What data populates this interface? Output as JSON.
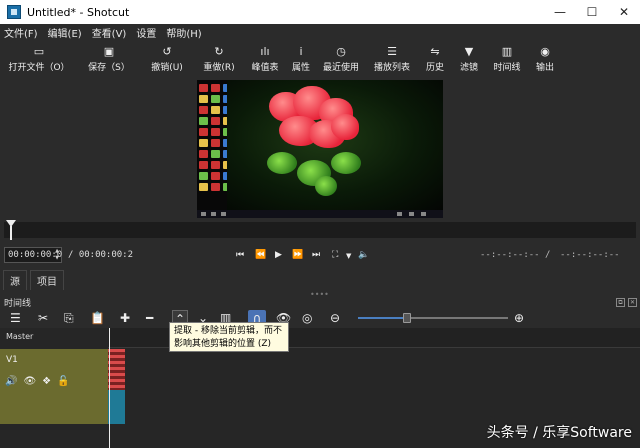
{
  "window": {
    "title": "Untitled* - Shotcut"
  },
  "menu": [
    "文件(F)",
    "编辑(E)",
    "查看(V)",
    "设置",
    "帮助(H)"
  ],
  "toolbar": [
    {
      "icon": "folder-open-icon",
      "glyph": "▭",
      "label": "打开文件（O）"
    },
    {
      "icon": "save-icon",
      "glyph": "▣",
      "label": "保存（S）"
    },
    {
      "icon": "undo-icon",
      "glyph": "↺",
      "label": "撤销(U)"
    },
    {
      "icon": "redo-icon",
      "glyph": "↻",
      "label": "重做(R)"
    },
    {
      "icon": "peak-meter-icon",
      "glyph": "ılı",
      "label": "峰值表"
    },
    {
      "icon": "properties-icon",
      "glyph": "ⅰ",
      "label": "属性"
    },
    {
      "icon": "recent-icon",
      "glyph": "◷",
      "label": "最近使用"
    },
    {
      "icon": "playlist-icon",
      "glyph": "☰",
      "label": "播放列表"
    },
    {
      "icon": "history-icon",
      "glyph": "⇋",
      "label": "历史"
    },
    {
      "icon": "filter-icon",
      "glyph": "▼",
      "label": "滤镜"
    },
    {
      "icon": "timeline-icon",
      "glyph": "▥",
      "label": "时间线"
    },
    {
      "icon": "export-icon",
      "glyph": "◉",
      "label": "输出"
    }
  ],
  "player": {
    "timecode": "00:00:00:0",
    "duration": "/ 00:00:00:2",
    "in_point": "--:--:--:-- /",
    "out_point": "--:--:--:--"
  },
  "tabs": {
    "source": "源",
    "project": "项目"
  },
  "timeline": {
    "title": "时间线",
    "master": "Master",
    "track": "V1",
    "tooltip": "提取 - 移除当前剪辑，而不影响其他剪辑的位置 (Z)"
  },
  "watermark": "头条号 / 乐享Software"
}
